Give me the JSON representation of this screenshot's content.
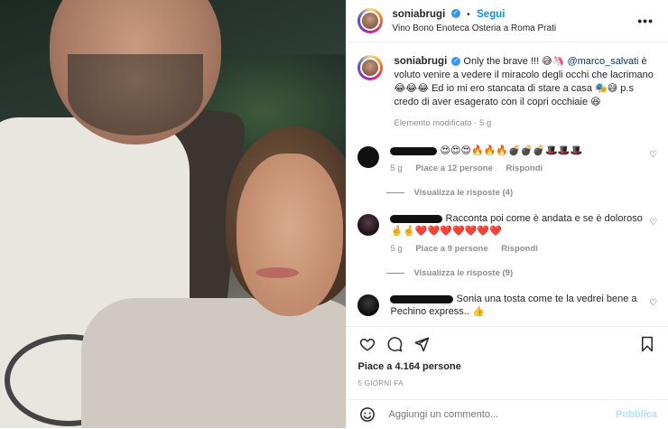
{
  "post": {
    "username": "soniabrugi",
    "follow_label": "Segui",
    "location": "Vino Bono Enoteca Osteria a Roma Prati",
    "more_icon": "more-options-icon"
  },
  "caption": {
    "username": "soniabrugi",
    "text_before_mention": "Only the brave !!! 😅🦄 ",
    "mention": "@marco_salvati",
    "text_after_mention": " è voluto venire a vedere il miracolo degli occhi che lacrimano 😂😂😂 Ed io mi ero stancata di stare a casa 🎭😅 p.s credo di aver esagerato con il copri occhiaie 😆",
    "meta": "Elemento modificato · 5 g"
  },
  "comments": [
    {
      "text": "😍😍😍🔥🔥🔥💣💣💣🎩🎩🎩",
      "time": "5 g",
      "likes": "Piace a 12 persone",
      "reply": "Rispondi",
      "view_replies": "Visualizza le risposte (4)"
    },
    {
      "text": "Racconta poi come è andata e se è doloroso 🤞🤞❤️❤️❤️❤️❤️❤️❤️",
      "time": "5 g",
      "likes": "Piace a 9 persone",
      "reply": "Rispondi",
      "view_replies": "Visualizza le risposte (9)"
    },
    {
      "text": " Sonia una tosta come te la vedrei bene a Pechino express.. 👍",
      "time": "",
      "likes": "",
      "reply": "",
      "view_replies": ""
    }
  ],
  "actions": {
    "likes": "Piace a 4.164 persone",
    "date": "5 GIORNI FA"
  },
  "add_comment": {
    "placeholder": "Aggiungi un commento...",
    "publish_label": "Pubblica"
  },
  "colors": {
    "link_blue": "#0095f6",
    "muted_gray": "#8e8e8e",
    "publish_disabled": "#b2dffc"
  }
}
